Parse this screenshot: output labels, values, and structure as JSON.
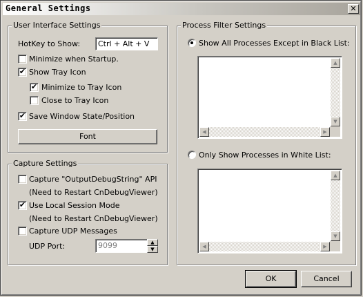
{
  "window": {
    "title": "General Settings",
    "close_glyph": "✕"
  },
  "ui_settings": {
    "legend": "User Interface Settings",
    "hotkey_label": "HotKey to Show:",
    "hotkey_value": "Ctrl + Alt + V",
    "minimize_startup": {
      "label": "Minimize when Startup.",
      "checked": false
    },
    "show_tray": {
      "label": "Show Tray Icon",
      "checked": true
    },
    "minimize_tray": {
      "label": "Minimize to Tray Icon",
      "checked": true
    },
    "close_tray": {
      "label": "Close to Tray Icon",
      "checked": false
    },
    "save_state": {
      "label": "Save Window State/Position",
      "checked": true
    },
    "font_button": "Font"
  },
  "capture_settings": {
    "legend": "Capture Settings",
    "capture_ods": {
      "label": "Capture \"OutputDebugString\" API",
      "checked": false
    },
    "ods_note": "(Need to Restart CnDebugViewer)",
    "local_session": {
      "label": "Use Local Session Mode",
      "checked": true
    },
    "session_note": "(Need to Restart CnDebugViewer)",
    "capture_udp": {
      "label": "Capture UDP Messages",
      "checked": false
    },
    "udp_port_label": "UDP Port:",
    "udp_port_value": "9099"
  },
  "process_filter": {
    "legend": "Process Filter Settings",
    "black_list_option": {
      "label": "Show All Processes Except in Black List:",
      "selected": true
    },
    "white_list_option": {
      "label": "Only Show Processes in White List:",
      "selected": false
    }
  },
  "buttons": {
    "ok": "OK",
    "cancel": "Cancel"
  },
  "icons": {
    "check": "✔",
    "scroll_up": "▲",
    "scroll_down": "▼",
    "scroll_left": "◀",
    "scroll_right": "▶"
  }
}
